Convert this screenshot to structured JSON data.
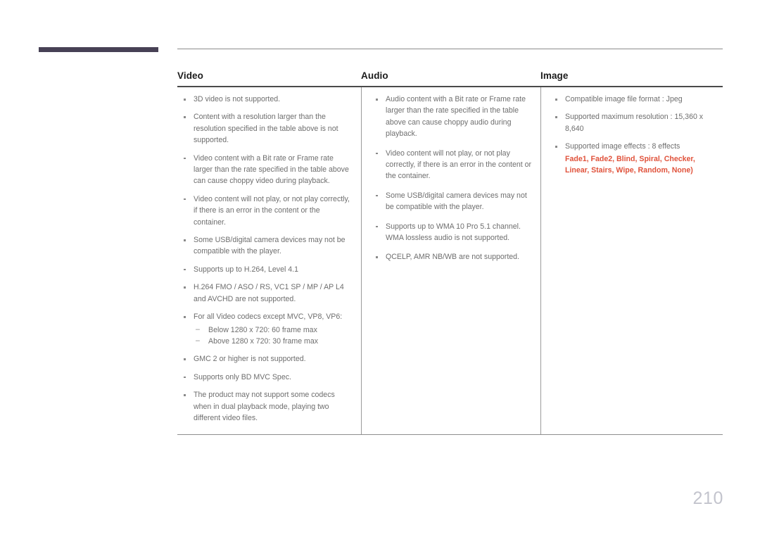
{
  "page": {
    "number": "210"
  },
  "table": {
    "headers": [
      {
        "label": "Video"
      },
      {
        "label": "Audio"
      },
      {
        "label": "Image"
      }
    ],
    "video_notes": [
      "3D video is not supported.",
      "Content with a resolution larger than the resolution specified in the table above is not supported.",
      "Video content with a Bit rate or Frame rate larger than the rate specified in the table above can cause choppy video during playback.",
      "Video content will not play, or not play correctly, if there is an error in the content or the container.",
      "Some USB/digital camera devices may not be compatible with the player.",
      "Supports up to H.264, Level 4.1",
      "H.264 FMO / ASO / RS, VC1 SP / MP / AP L4 and AVCHD are not supported.",
      "For all Video codecs except MVC, VP8, VP6:",
      "GMC 2 or higher is not supported.",
      "Supports only BD MVC Spec.",
      "The product may not support some codecs when in dual playback mode, playing two different video files."
    ],
    "video_subnotes": [
      "Below 1280 x 720: 60 frame max",
      "Above 1280 x 720: 30 frame max"
    ],
    "audio_notes": [
      "Audio content with a Bit rate or Frame rate larger than the rate specified in the table above can cause choppy audio during playback.",
      "Video content will not play, or not play correctly, if there is an error in the content or the container.",
      "Some USB/digital camera devices may not be compatible with the player.",
      "Supports up to WMA 10 Pro 5.1 channel. WMA lossless audio is not supported.",
      "QCELP, AMR NB/WB are not supported."
    ],
    "image_notes": [
      "Compatible image file format : Jpeg",
      "Supported maximum resolution : 15,360 x 8,640",
      "Supported image effects : 8 effects"
    ],
    "image_effects": "Fade1, Fade2, Blind, Spiral, Checker, Linear, Stairs, Wipe, Random, None)"
  },
  "colors": {
    "accent": "#e0523b",
    "deco_bar": "#474155",
    "body_text": "#6e6e6e",
    "header_text": "#1c1c1c",
    "page_number": "#c3c4cd"
  }
}
